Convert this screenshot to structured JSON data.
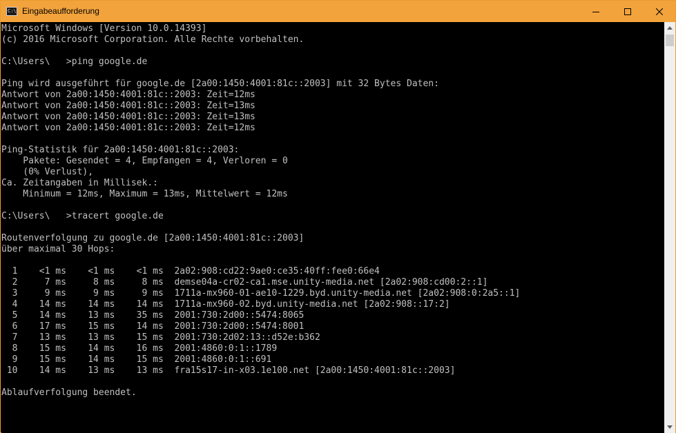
{
  "window": {
    "title": "Eingabeaufforderung",
    "icon_name": "command-prompt-icon",
    "icon_glyph": "C:\\",
    "title_bar_color": "#f2a33c",
    "controls": {
      "minimize_icon": "minimize-icon",
      "maximize_icon": "maximize-icon",
      "close_icon": "close-icon"
    }
  },
  "console": {
    "text_color": "#c0c0c0",
    "background_color": "#000000",
    "lines": [
      "Microsoft Windows [Version 10.0.14393]",
      "(c) 2016 Microsoft Corporation. Alle Rechte vorbehalten.",
      "",
      "C:\\Users\\   >ping google.de",
      "",
      "Ping wird ausgeführt für google.de [2a00:1450:4001:81c::2003] mit 32 Bytes Daten:",
      "Antwort von 2a00:1450:4001:81c::2003: Zeit=12ms",
      "Antwort von 2a00:1450:4001:81c::2003: Zeit=13ms",
      "Antwort von 2a00:1450:4001:81c::2003: Zeit=13ms",
      "Antwort von 2a00:1450:4001:81c::2003: Zeit=12ms",
      "",
      "Ping-Statistik für 2a00:1450:4001:81c::2003:",
      "    Pakete: Gesendet = 4, Empfangen = 4, Verloren = 0",
      "    (0% Verlust),",
      "Ca. Zeitangaben in Millisek.:",
      "    Minimum = 12ms, Maximum = 13ms, Mittelwert = 12ms",
      "",
      "C:\\Users\\   >tracert google.de",
      "",
      "Routenverfolgung zu google.de [2a00:1450:4001:81c::2003]",
      "über maximal 30 Hops:",
      "",
      "  1    <1 ms    <1 ms    <1 ms  2a02:908:cd22:9ae0:ce35:40ff:fee0:66e4",
      "  2     7 ms     8 ms     8 ms  demse04a-cr02-ca1.mse.unity-media.net [2a02:908:cd00:2::1]",
      "  3     9 ms     9 ms     9 ms  1711a-mx960-01-ae10-1229.byd.unity-media.net [2a02:908:0:2a5::1]",
      "  4    14 ms    14 ms    14 ms  1711a-mx960-02.byd.unity-media.net [2a02:908::17:2]",
      "  5    14 ms    13 ms    35 ms  2001:730:2d00::5474:8065",
      "  6    17 ms    15 ms    14 ms  2001:730:2d00::5474:8001",
      "  7    13 ms    13 ms    15 ms  2001:730:2d02:13::d52e:b362",
      "  8    15 ms    14 ms    16 ms  2001:4860:0:1::1789",
      "  9    15 ms    14 ms    15 ms  2001:4860:0:1::691",
      " 10    14 ms    13 ms    13 ms  fra15s17-in-x03.1e100.net [2a00:1450:4001:81c::2003]",
      "",
      "Ablaufverfolgung beendet."
    ]
  },
  "scrollbar": {
    "up_icon": "scroll-up-arrow-icon",
    "down_icon": "scroll-down-arrow-icon"
  }
}
